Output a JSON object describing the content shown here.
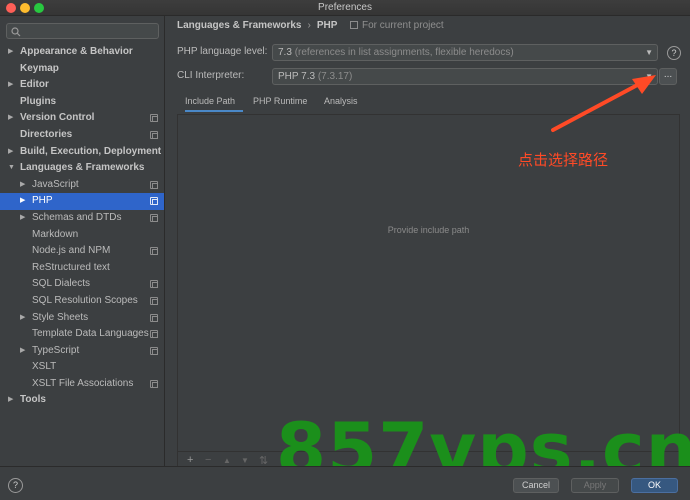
{
  "window": {
    "title": "Preferences"
  },
  "sidebar": {
    "items": [
      {
        "label": "Appearance & Behavior",
        "bold": true,
        "arrow": "▶",
        "level": 0,
        "proj": false
      },
      {
        "label": "Keymap",
        "bold": true,
        "arrow": "",
        "level": 0,
        "proj": false
      },
      {
        "label": "Editor",
        "bold": true,
        "arrow": "▶",
        "level": 0,
        "proj": false
      },
      {
        "label": "Plugins",
        "bold": true,
        "arrow": "",
        "level": 0,
        "proj": false
      },
      {
        "label": "Version Control",
        "bold": true,
        "arrow": "▶",
        "level": 0,
        "proj": true
      },
      {
        "label": "Directories",
        "bold": true,
        "arrow": "",
        "level": 0,
        "proj": true
      },
      {
        "label": "Build, Execution, Deployment",
        "bold": true,
        "arrow": "▶",
        "level": 0,
        "proj": false
      },
      {
        "label": "Languages & Frameworks",
        "bold": true,
        "arrow": "▼",
        "level": 0,
        "proj": false
      },
      {
        "label": "JavaScript",
        "bold": false,
        "arrow": "▶",
        "level": 1,
        "proj": true
      },
      {
        "label": "PHP",
        "bold": false,
        "arrow": "▶",
        "level": 1,
        "proj": true,
        "selected": true
      },
      {
        "label": "Schemas and DTDs",
        "bold": false,
        "arrow": "▶",
        "level": 1,
        "proj": true
      },
      {
        "label": "Markdown",
        "bold": false,
        "arrow": "",
        "level": 1,
        "proj": false
      },
      {
        "label": "Node.js and NPM",
        "bold": false,
        "arrow": "",
        "level": 1,
        "proj": true
      },
      {
        "label": "ReStructured text",
        "bold": false,
        "arrow": "",
        "level": 1,
        "proj": false
      },
      {
        "label": "SQL Dialects",
        "bold": false,
        "arrow": "",
        "level": 1,
        "proj": true
      },
      {
        "label": "SQL Resolution Scopes",
        "bold": false,
        "arrow": "",
        "level": 1,
        "proj": true
      },
      {
        "label": "Style Sheets",
        "bold": false,
        "arrow": "▶",
        "level": 1,
        "proj": true
      },
      {
        "label": "Template Data Languages",
        "bold": false,
        "arrow": "",
        "level": 1,
        "proj": true
      },
      {
        "label": "TypeScript",
        "bold": false,
        "arrow": "▶",
        "level": 1,
        "proj": true
      },
      {
        "label": "XSLT",
        "bold": false,
        "arrow": "",
        "level": 1,
        "proj": false
      },
      {
        "label": "XSLT File Associations",
        "bold": false,
        "arrow": "",
        "level": 1,
        "proj": true
      },
      {
        "label": "Tools",
        "bold": true,
        "arrow": "▶",
        "level": 0,
        "proj": false
      }
    ]
  },
  "breadcrumb": {
    "parent": "Languages & Frameworks",
    "separator": "›",
    "current": "PHP",
    "note": "For current project"
  },
  "settings": {
    "language_level_label": "PHP language level:",
    "language_level_value": "7.3",
    "language_level_hint": "(references in list assignments, flexible heredocs)",
    "cli_label": "CLI Interpreter:",
    "cli_value": "PHP 7.3",
    "cli_version": "(7.3.17)",
    "more_button": "...",
    "help": "?"
  },
  "tabs": [
    {
      "label": "Include Path",
      "active": true
    },
    {
      "label": "PHP Runtime",
      "active": false
    },
    {
      "label": "Analysis",
      "active": false
    }
  ],
  "panel": {
    "empty_text": "Provide include path",
    "toolbar": [
      "+",
      "−",
      "▲",
      "▼",
      "⇅"
    ]
  },
  "annotation": {
    "text": "点击选择路径",
    "color": "#ff4a26"
  },
  "watermark": {
    "text": "857vps.cn",
    "color": "#1b8f1b"
  },
  "footer": {
    "help": "?",
    "cancel": "Cancel",
    "apply": "Apply",
    "ok": "OK"
  },
  "colors": {
    "background": "#3c3f41",
    "selection": "#2f65ca",
    "accent_tab": "#4a88c7",
    "ok_button": "#365880"
  }
}
